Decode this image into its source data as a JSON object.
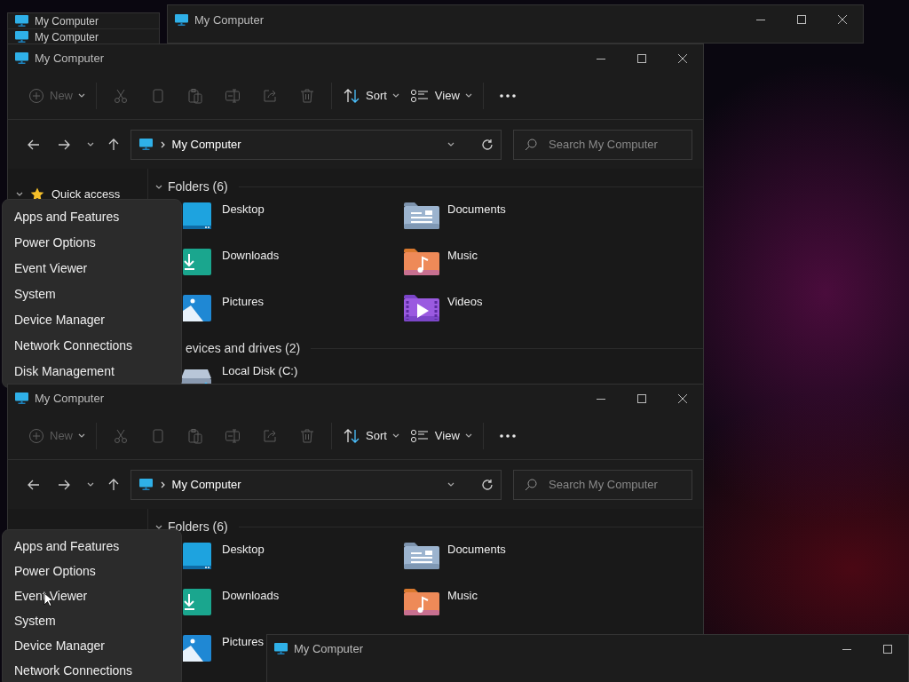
{
  "background_windows": [
    {
      "title": "My Computer"
    },
    {
      "title": "My Computer"
    }
  ],
  "top_window": {
    "title": "My Computer"
  },
  "explorers": [
    {
      "title": "My Computer",
      "toolbar": [
        {
          "kind": "new",
          "label": "New",
          "disabled": true
        },
        {
          "kind": "cut",
          "disabled": true
        },
        {
          "kind": "copy",
          "disabled": true
        },
        {
          "kind": "paste",
          "disabled": true
        },
        {
          "kind": "rename",
          "disabled": true
        },
        {
          "kind": "share",
          "disabled": true
        },
        {
          "kind": "delete",
          "disabled": true
        },
        {
          "kind": "sort",
          "label": "Sort",
          "disabled": false
        },
        {
          "kind": "view",
          "label": "View",
          "disabled": false
        },
        {
          "kind": "more",
          "disabled": false
        }
      ],
      "address": "My Computer",
      "search": {
        "placeholder": "Search My Computer"
      },
      "navigation": [
        {
          "label": "Quick access"
        }
      ],
      "sections": [
        {
          "kind": "folders",
          "header": "Folders (6)",
          "items": [
            {
              "kind": "desktop",
              "name": "Desktop"
            },
            {
              "kind": "documents",
              "name": "Documents"
            },
            {
              "kind": "downloads",
              "name": "Downloads"
            },
            {
              "kind": "music",
              "name": "Music"
            },
            {
              "kind": "pictures",
              "name": "Pictures"
            },
            {
              "kind": "videos",
              "name": "Videos"
            }
          ]
        },
        {
          "kind": "drives",
          "header": "evices and drives (2)",
          "items": [
            {
              "kind": "drive",
              "name": "Local Disk (C:)"
            }
          ]
        }
      ],
      "context_menu": [
        "Apps and Features",
        "Power Options",
        "Event Viewer",
        "System",
        "Device Manager",
        "Network Connections",
        "Disk Management"
      ]
    },
    {
      "title": "My Computer",
      "toolbar": [
        {
          "kind": "new",
          "label": "New",
          "disabled": true
        },
        {
          "kind": "cut",
          "disabled": true
        },
        {
          "kind": "copy",
          "disabled": true
        },
        {
          "kind": "paste",
          "disabled": true
        },
        {
          "kind": "rename",
          "disabled": true
        },
        {
          "kind": "share",
          "disabled": true
        },
        {
          "kind": "delete",
          "disabled": true
        },
        {
          "kind": "sort",
          "label": "Sort",
          "disabled": false
        },
        {
          "kind": "view",
          "label": "View",
          "disabled": false
        },
        {
          "kind": "more",
          "disabled": false
        }
      ],
      "address": "My Computer",
      "search": {
        "placeholder": "Search My Computer"
      },
      "sections": [
        {
          "kind": "folders",
          "header": "Folders (6)",
          "items": [
            {
              "kind": "desktop",
              "name": "Desktop"
            },
            {
              "kind": "documents",
              "name": "Documents"
            },
            {
              "kind": "downloads",
              "name": "Downloads"
            },
            {
              "kind": "music",
              "name": "Music"
            },
            {
              "kind": "pictures",
              "name": "Pictures"
            }
          ]
        }
      ],
      "context_menu": [
        "Apps and Features",
        "Power Options",
        "Event Viewer",
        "System",
        "Device Manager",
        "Network Connections"
      ]
    }
  ],
  "front_window": {
    "title": "My Computer"
  }
}
